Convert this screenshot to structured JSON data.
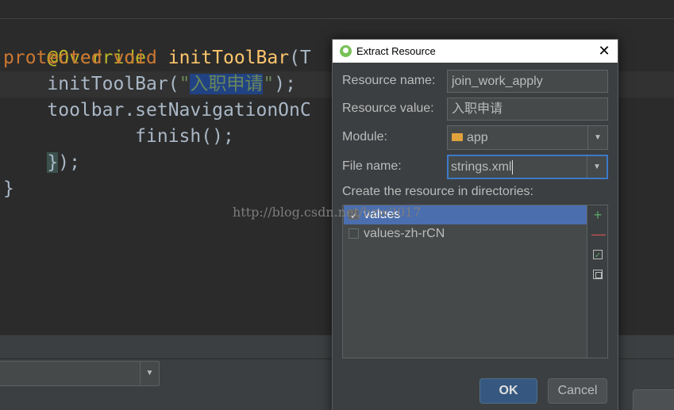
{
  "editor": {
    "line1": "@Override",
    "line2_kw1": "protected",
    "line2_kw2": "void",
    "line2_fn": "initToolBar",
    "line2_rest": "(T",
    "line3_call": "initToolBar(",
    "line3_q1": "\"",
    "line3_selected": "入职申请",
    "line3_q2": "\"",
    "line3_end": ");",
    "line4": "toolbar.setNavigationOnC",
    "line5": "finish();",
    "line5_semi": "",
    "line6_brace": "}",
    "line6_end": ");",
    "line7": "}",
    "watermark": "http://blog.csdn.net/hzw2017"
  },
  "dialog": {
    "title": "Extract Resource",
    "close_glyph": "✕",
    "resource_name_label": "Resource name:",
    "resource_name_value": "join_work_apply",
    "resource_value_label": "Resource value:",
    "resource_value_value": "入职申请",
    "module_label": "Module:",
    "module_value": "app",
    "file_name_label": "File name:",
    "file_name_value": "strings.xml",
    "directories_label": "Create the resource in directories:",
    "directories": [
      {
        "label": "values",
        "checked": true
      },
      {
        "label": "values-zh-rCN",
        "checked": false
      }
    ],
    "add_glyph": "+",
    "remove_glyph": "—",
    "select_all_glyph": "✓",
    "ok_label": "OK",
    "cancel_label": "Cancel"
  },
  "icons": {
    "title_icon": "android-studio-icon",
    "module_icon": "module-folder-icon"
  }
}
